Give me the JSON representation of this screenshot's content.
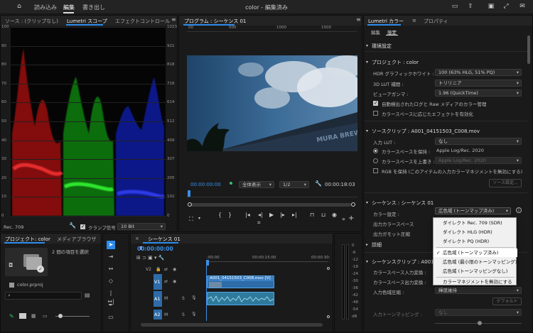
{
  "app": {
    "window_title": "color - 編集済み",
    "menu": [
      "読み込み",
      "編集",
      "書き出し"
    ],
    "active_menu_index": 1
  },
  "source_panel": {
    "tabs": [
      "ソース : (クリップなし)",
      "Lumetri スコープ",
      "エフェクトコントロール"
    ],
    "active_tab_index": 1,
    "left_axis": [
      "100",
      "90",
      "80",
      "70",
      "60",
      "50",
      "40",
      "30",
      "20",
      "10",
      "0"
    ],
    "right_axis": [
      "1023",
      "921",
      "818",
      "716",
      "614",
      "512",
      "409",
      "307",
      "205",
      "102",
      "0"
    ],
    "colorspace": "Rec. 709",
    "clamp_label": "クランプ信号",
    "clamp_checked": true,
    "bit_depth": "10 Bit"
  },
  "program_panel": {
    "title": "プログラム : シーケンス 01",
    "ruler_labels": [
      "00",
      "500",
      "1000",
      "1500"
    ],
    "timecode": "00:00:00:00",
    "fit": "全体表示",
    "resolution": "1/2",
    "duration": "00:00:18:03",
    "watermark": "MURA BREWERY"
  },
  "project_panel": {
    "tabs": [
      "プロジェクト: color",
      "メディアブラウザ"
    ],
    "active_tab_index": 0,
    "selection_text": "2 個の項目を選択",
    "file_name": "color.prproj"
  },
  "timeline": {
    "title": "シーケンス 01",
    "timecode": "00:00:00:00",
    "ruler_labels": [
      ":00:00",
      "00:00:15:00",
      "00:00:30:"
    ],
    "tracks": [
      "V2",
      "V1",
      "A1",
      "A2"
    ],
    "clip_name": "A001_04151503_C008.mov [V]",
    "meter_labels": [
      "0",
      "-6",
      "-12",
      "-18",
      "-24",
      "-30",
      "-36",
      "-42",
      "-48",
      "-54",
      "dB"
    ]
  },
  "lumetri": {
    "tabs": [
      "Lumetri カラー",
      "プロパティ"
    ],
    "active_tab_index": 0,
    "subtabs": [
      "編集",
      "設定"
    ],
    "active_subtab_index": 1,
    "env_header": "環境設定",
    "project_header": "プロジェクト : color",
    "hdr_white_label": "HDR グラフィックホワイト :",
    "hdr_white_value": "100 (63% HLG, 51% PQ)",
    "lut_interp_label": "3D LUT 補間 :",
    "lut_interp_value": "トリリニア",
    "viewer_gamma_label": "ビューアガンマ :",
    "viewer_gamma_value": "1.96 (QuickTime)",
    "auto_detect_label": "自動検出されたログと Raw メディアのカラー管理",
    "auto_detect_checked": true,
    "colorspace_effects_label": "カラースペースに応じたエフェクトを有効化",
    "colorspace_effects_checked": false,
    "source_clip_header": "ソースクリップ : A001_04151503_C008.mov",
    "input_lut_label": "入力 LUT :",
    "input_lut_value": "なし",
    "preserve_cs_label": "カラースペースを保持 :",
    "preserve_cs_value": "Apple Log/Rec. 2020",
    "override_cs_label": "カラースペースを上書き :",
    "override_cs_value": "Apple Log/Rec. 2020",
    "rgb_preserve_label": "RGB を保持 (このアイテムの入力カラーマネジメントを無効にする)",
    "source_settings_button": "ソース設定...",
    "sequence_header": "シーケンス : シーケンス 01",
    "color_settings_label": "カラー設定 :",
    "color_settings_value": "広色域 (トーンマップ済み)",
    "output_cs_label": "出力カラースペース",
    "output_gamut_label": "出力ガモット圧縮",
    "details_header": "詳細",
    "seq_clip_header": "シーケンスクリップ : A001_0",
    "cs_input_label": "カラースペース入力変換 :",
    "cs_output_label": "カラースペース出力変換 :",
    "input_gamut_label": "入力色域圧縮 :",
    "input_gamut_value": "輝度維持",
    "default_button": "デフォルト",
    "input_tonemap_label": "入力トーンマッピング :",
    "input_tonemap_value": "なし",
    "dropdown_menu": [
      "ダイレクト Rec. 709 (SDR)",
      "ダイレクト HLG (HDR)",
      "ダイレクト PQ (HDR)",
      "広色域 (トーンマップ済み)",
      "広色域 (最小限のトーンマッピング)",
      "広色域 (トーンマッピングなし)",
      "カラーマネジメントを無効にする"
    ],
    "dropdown_selected_index": 3
  },
  "colors": {
    "accent": "#2d8ceb",
    "timecode": "#3a8fe8",
    "clip": "#2d6ca8",
    "audio_clip": "#2e7a9c"
  }
}
